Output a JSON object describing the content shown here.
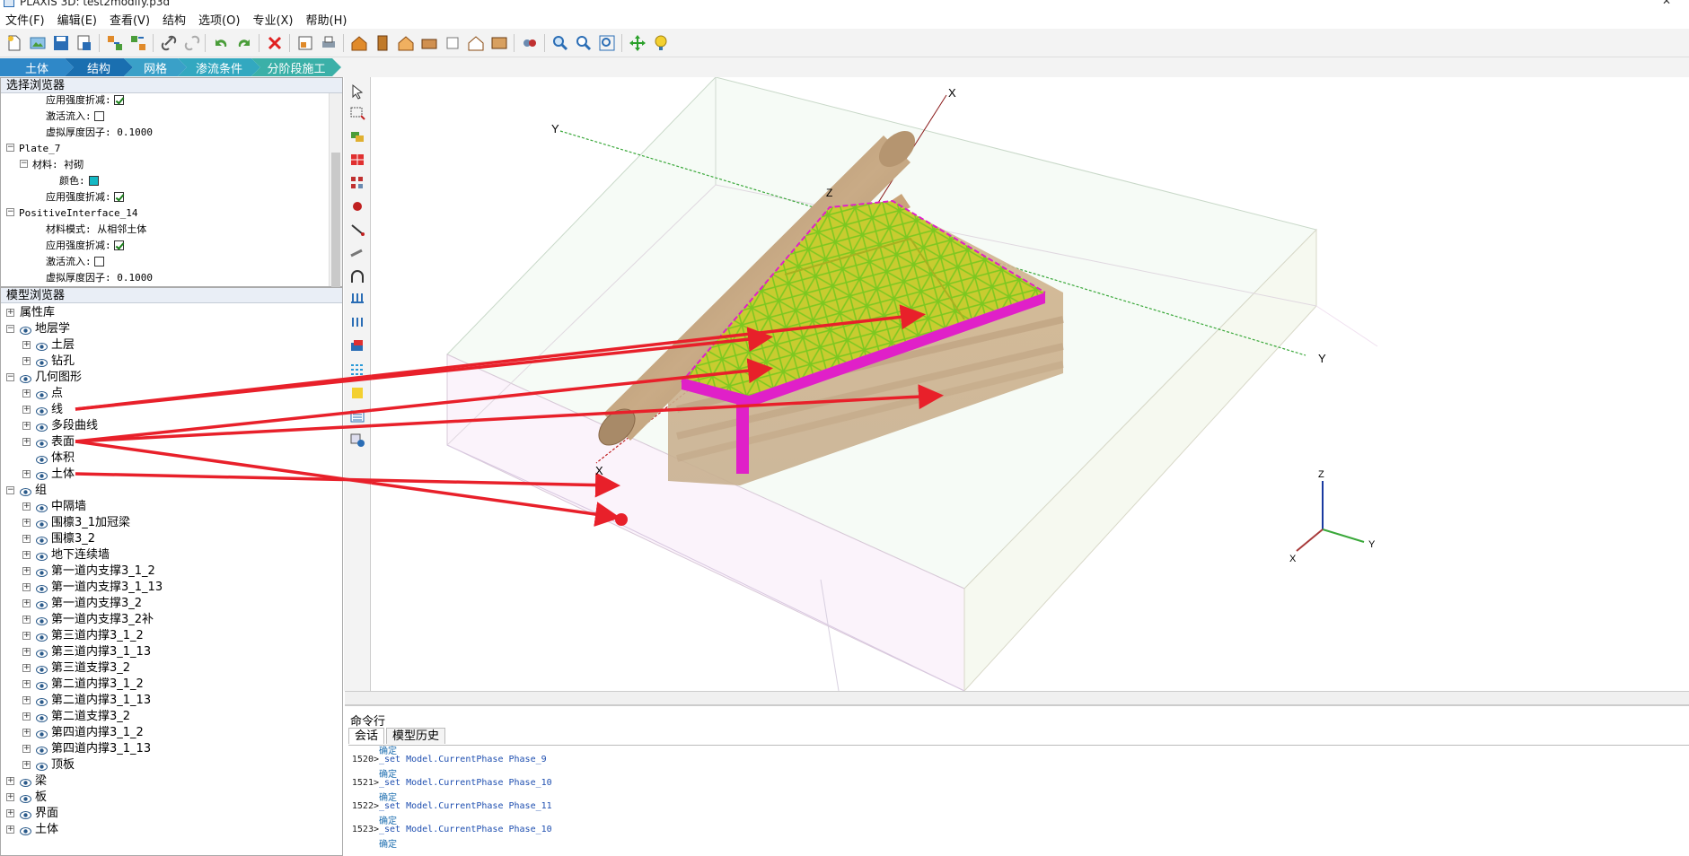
{
  "window": {
    "title": "PLAXIS 3D: test2modify.p3d"
  },
  "menu": [
    "文件(F)",
    "编辑(E)",
    "查看(V)",
    "结构",
    "选项(O)",
    "专业(X)",
    "帮助(H)"
  ],
  "modes": [
    {
      "label": "土体",
      "color": "#2f88c8"
    },
    {
      "label": "结构",
      "color": "#1a6fb0"
    },
    {
      "label": "网格",
      "color": "#3aa0c8"
    },
    {
      "label": "渗流条件",
      "color": "#33a8c0"
    },
    {
      "label": "分阶段施工",
      "color": "#3bb0a8"
    }
  ],
  "selection_browser": {
    "title": "选择浏览器",
    "rows": [
      {
        "text": "应用强度折减:",
        "indent": 50,
        "checkbox": true,
        "checked": true
      },
      {
        "text": "激活流入:",
        "indent": 50,
        "checkbox": true,
        "checked": false
      },
      {
        "text": "虚拟厚度因子: 0.1000",
        "indent": 50
      },
      {
        "text": "Plate_7",
        "indent": 20,
        "expander": "−"
      },
      {
        "text": "材料: 衬砌",
        "indent": 35,
        "expander": "−"
      },
      {
        "text": "颜色:",
        "indent": 65,
        "swatch": true
      },
      {
        "text": "应用强度折减:",
        "indent": 50,
        "checkbox": true,
        "checked": true
      },
      {
        "text": "PositiveInterface_14",
        "indent": 20,
        "expander": "−"
      },
      {
        "text": "材料模式: 从相邻土体",
        "indent": 50
      },
      {
        "text": "应用强度折减:",
        "indent": 50,
        "checkbox": true,
        "checked": true
      },
      {
        "text": "激活流入:",
        "indent": 50,
        "checkbox": true,
        "checked": false
      },
      {
        "text": "虚拟厚度因子: 0.1000",
        "indent": 50
      }
    ]
  },
  "model_browser": {
    "title": "模型浏览器",
    "rows": [
      {
        "text": "属性库",
        "level": 0,
        "expander": "+",
        "eye": false
      },
      {
        "text": "地层学",
        "level": 0,
        "expander": "−",
        "eye": true
      },
      {
        "text": "土层",
        "level": 1,
        "expander": "+",
        "eye": true
      },
      {
        "text": "钻孔",
        "level": 1,
        "expander": "+",
        "eye": true
      },
      {
        "text": "几何图形",
        "level": 0,
        "expander": "−",
        "eye": true
      },
      {
        "text": "点",
        "level": 1,
        "expander": "+",
        "eye": true
      },
      {
        "text": "线",
        "level": 1,
        "expander": "+",
        "eye": true
      },
      {
        "text": "多段曲线",
        "level": 1,
        "expander": "+",
        "eye": true
      },
      {
        "text": "表面",
        "level": 1,
        "expander": "+",
        "eye": true
      },
      {
        "text": "体积",
        "level": 1,
        "expander": "",
        "eye": true
      },
      {
        "text": "土体",
        "level": 1,
        "expander": "+",
        "eye": true
      },
      {
        "text": "组",
        "level": 0,
        "expander": "−",
        "eye": true
      },
      {
        "text": "中隔墙",
        "level": 1,
        "expander": "+",
        "eye": true
      },
      {
        "text": "围檩3_1加冠梁",
        "level": 1,
        "expander": "+",
        "eye": true
      },
      {
        "text": "围檩3_2",
        "level": 1,
        "expander": "+",
        "eye": true
      },
      {
        "text": "地下连续墙",
        "level": 1,
        "expander": "+",
        "eye": true
      },
      {
        "text": "第一道内支撑3_1_2",
        "level": 1,
        "expander": "+",
        "eye": true
      },
      {
        "text": "第一道内支撑3_1_13",
        "level": 1,
        "expander": "+",
        "eye": true
      },
      {
        "text": "第一道内支撑3_2",
        "level": 1,
        "expander": "+",
        "eye": true
      },
      {
        "text": "第一道内支撑3_2补",
        "level": 1,
        "expander": "+",
        "eye": true
      },
      {
        "text": "第三道内撑3_1_2",
        "level": 1,
        "expander": "+",
        "eye": true
      },
      {
        "text": "第三道内撑3_1_13",
        "level": 1,
        "expander": "+",
        "eye": true
      },
      {
        "text": "第三道支撑3_2",
        "level": 1,
        "expander": "+",
        "eye": true
      },
      {
        "text": "第二道内撑3_1_2",
        "level": 1,
        "expander": "+",
        "eye": true
      },
      {
        "text": "第二道内撑3_1_13",
        "level": 1,
        "expander": "+",
        "eye": true
      },
      {
        "text": "第二道支撑3_2",
        "level": 1,
        "expander": "+",
        "eye": true
      },
      {
        "text": "第四道内撑3_1_2",
        "level": 1,
        "expander": "+",
        "eye": true
      },
      {
        "text": "第四道内撑3_1_13",
        "level": 1,
        "expander": "+",
        "eye": true
      },
      {
        "text": "顶板",
        "level": 1,
        "expander": "+",
        "eye": true
      },
      {
        "text": "梁",
        "level": 0,
        "expander": "+",
        "eye": true
      },
      {
        "text": "板",
        "level": 0,
        "expander": "+",
        "eye": true
      },
      {
        "text": "界面",
        "level": 0,
        "expander": "+",
        "eye": true
      },
      {
        "text": "土体",
        "level": 0,
        "expander": "+",
        "eye": true
      }
    ]
  },
  "viewport": {
    "axis_labels": {
      "x_top": "X",
      "y_left": "Y",
      "z_top": "Z",
      "y_right": "Y",
      "x_bottom": "X"
    },
    "triad": {
      "z": "Z",
      "y": "Y",
      "x": "X"
    }
  },
  "command_panel": {
    "title": "命令行",
    "tabs": [
      "会话",
      "模型历史"
    ],
    "log": [
      {
        "num": "",
        "ok": "确定",
        "cmd": ""
      },
      {
        "num": "1520>",
        "ok": "",
        "cmd": "_set Model.CurrentPhase Phase_9"
      },
      {
        "num": "",
        "ok": "确定",
        "cmd": ""
      },
      {
        "num": "1521>",
        "ok": "",
        "cmd": "_set Model.CurrentPhase Phase_10"
      },
      {
        "num": "",
        "ok": "确定",
        "cmd": ""
      },
      {
        "num": "1522>",
        "ok": "",
        "cmd": "_set Model.CurrentPhase Phase_11"
      },
      {
        "num": "",
        "ok": "确定",
        "cmd": ""
      },
      {
        "num": "1523>",
        "ok": "",
        "cmd": "_set Model.CurrentPhase Phase_10"
      },
      {
        "num": "",
        "ok": "确定",
        "cmd": ""
      }
    ]
  },
  "colors": {
    "arrow": "#e8202a",
    "slab": "#c8cc30",
    "mesh": "#7cc820",
    "wall": "#e020c8",
    "soil": "#c8b090",
    "tunnel": "#b89a78"
  }
}
